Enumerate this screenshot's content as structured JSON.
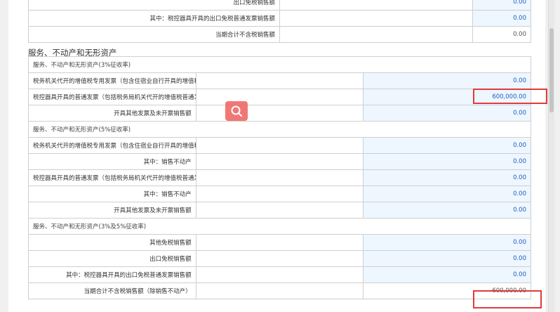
{
  "top_table": {
    "rows": [
      {
        "label": "出口免税销售额",
        "value": "0.00",
        "editable": true
      },
      {
        "label": "其中：税控器具开具的出口免税普通发票销售额",
        "value": "0.00",
        "editable": true
      },
      {
        "label": "当期合计不含税销售额",
        "value": "0.00",
        "editable": false
      }
    ]
  },
  "section": {
    "title": "服务、不动产和无形资产"
  },
  "main_table": {
    "rows": [
      {
        "type": "section",
        "label": "服务、不动产和无形资产(3%征收率)"
      },
      {
        "label": "税务机关代开的增值税专用发票（包含住宿业自行开具的增值税专用发票）不含税销售额",
        "value": "0.00",
        "editable": true
      },
      {
        "label": "税控器具开具的普通发票（包括税务局机关代开的增值税普通发票）不含税销售额",
        "value": "600,000.00",
        "editable": true
      },
      {
        "label": "开具其他发票及未开票销售额",
        "value": "0.00",
        "editable": true
      },
      {
        "type": "section",
        "label": "服务、不动产和无形资产(5%征收率)"
      },
      {
        "label": "税务机关代开的增值税专用发票（包含住宿业自行开具的增值税专用发票）不含税销售额",
        "value": "0.00",
        "editable": true
      },
      {
        "label": "其中：销售不动产",
        "value": "0.00",
        "editable": true
      },
      {
        "label": "税控器具开具的普通发票（包括税务局机关代开的增值税普通发票）不含税销售额",
        "value": "0.00",
        "editable": true
      },
      {
        "label": "其中：销售不动产",
        "value": "0.00",
        "editable": true
      },
      {
        "label": "开具其他发票及未开票销售额",
        "value": "0.00",
        "editable": true
      },
      {
        "type": "section",
        "label": "服务、不动产和无形资产(3%及5%征收率)"
      },
      {
        "label": "其他免税销售额",
        "value": "0.00",
        "editable": true
      },
      {
        "label": "出口免税销售额",
        "value": "0.00",
        "editable": true
      },
      {
        "label": "其中：税控器具开具的出口免税普通发票销售额",
        "value": "0.00",
        "editable": true
      },
      {
        "label": "当期合计不含税销售额（除销售不动产）",
        "value": "600,000.00",
        "editable": false
      }
    ]
  },
  "overlay": {
    "icon": "search-icon",
    "color": "#f06c6c"
  },
  "highlight_color": "#e03b3b"
}
